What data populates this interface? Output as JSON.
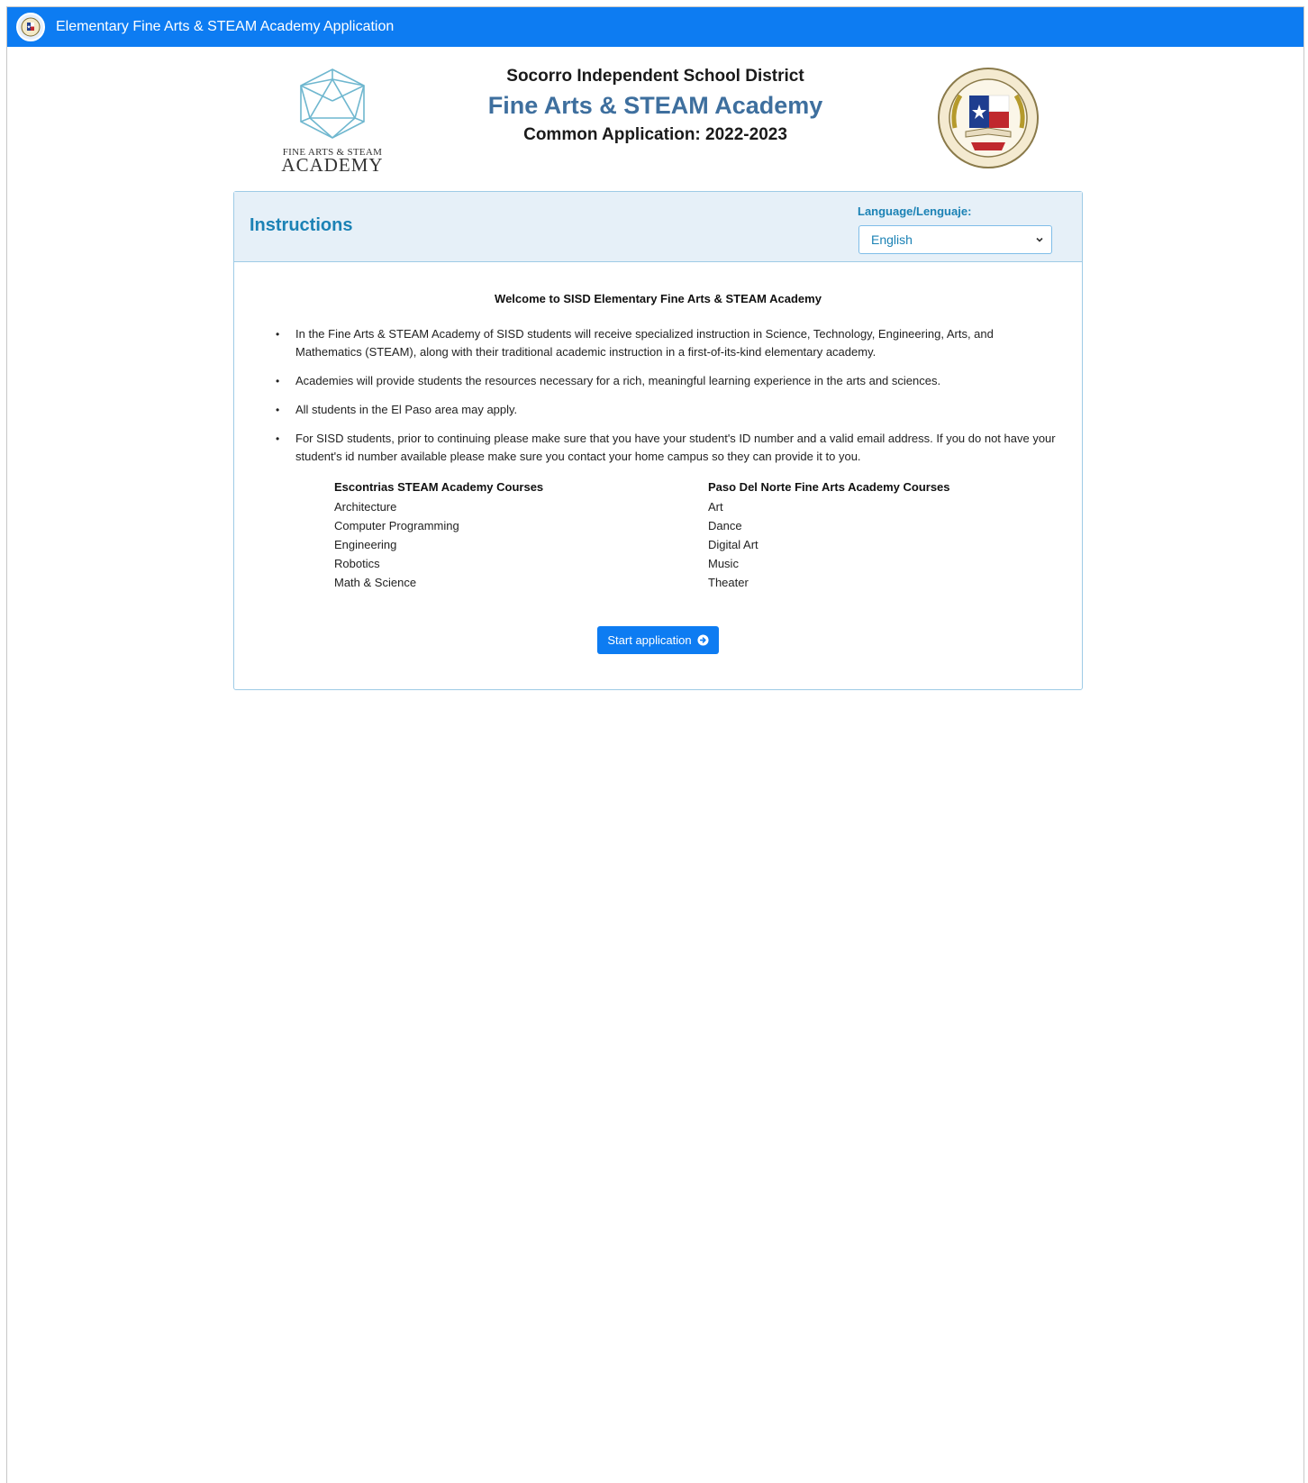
{
  "navbar": {
    "title": "Elementary Fine Arts & STEAM Academy Application",
    "logo_icon": "district-seal-icon",
    "color": "#0d7cf2"
  },
  "header": {
    "academy_logo_text_top": "FINE ARTS & STEAM",
    "academy_logo_text_bottom": "ACADEMY",
    "district": "Socorro Independent School District",
    "academy": "Fine Arts & STEAM Academy",
    "application": "Common Application: 2022-2023",
    "seal_icon": "district-seal-icon"
  },
  "instructions": {
    "title": "Instructions",
    "language_label": "Language/Lenguaje:",
    "language_selected": "English",
    "welcome": "Welcome to SISD Elementary Fine Arts & STEAM Academy",
    "bullets": [
      "In the Fine Arts & STEAM Academy of SISD students will receive specialized instruction in Science, Technology, Engineering, Arts, and Mathematics (STEAM), along with their traditional academic instruction in a first-of-its-kind elementary academy.",
      "Academies will provide students the resources necessary for a rich, meaningful learning experience in the arts and sciences.",
      "All students in the El Paso area may apply.",
      "For SISD students, prior to continuing please make sure that you have your student's ID number and a valid email address. If you do not have your student's id number available please make sure you contact your home campus so they can provide it to you."
    ],
    "courses": {
      "escontrias": {
        "heading": "Escontrias STEAM Academy Courses",
        "items": [
          "Architecture",
          "Computer Programming",
          "Engineering",
          "Robotics",
          "Math & Science"
        ]
      },
      "paso_del_norte": {
        "heading": "Paso Del Norte Fine Arts Academy Courses",
        "items": [
          "Art",
          "Dance",
          "Digital Art",
          "Music",
          "Theater"
        ]
      }
    },
    "start_button": "Start application",
    "start_icon": "arrow-circle-right-icon"
  },
  "colors": {
    "primary": "#0d7cf2",
    "heading_blue": "#1b82b5",
    "academy_blue": "#3e6f9e",
    "card_header_bg": "#e6f0f8"
  }
}
